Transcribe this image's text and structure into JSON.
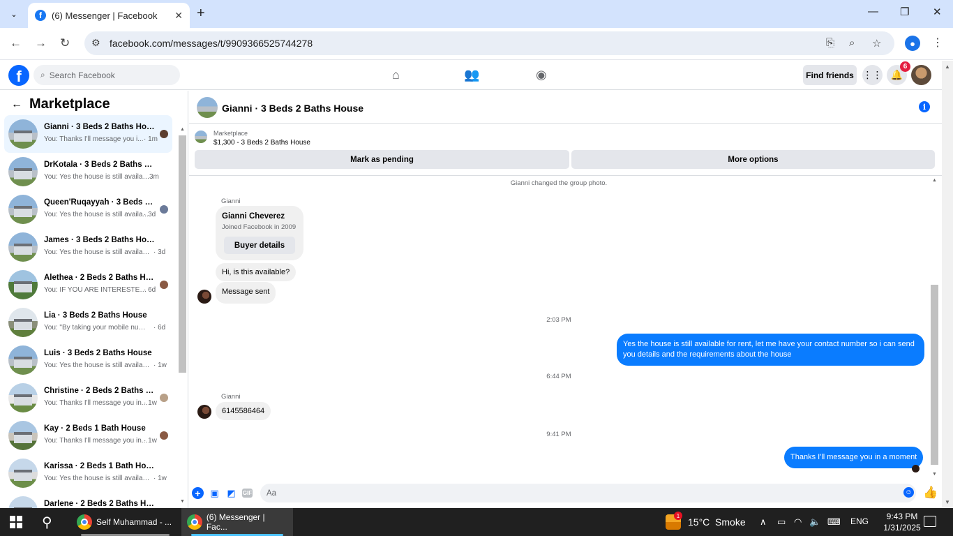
{
  "browser": {
    "tab_title": "(6) Messenger | Facebook",
    "url": "facebook.com/messages/t/9909366525744278"
  },
  "fb": {
    "search_placeholder": "Search Facebook",
    "find_friends": "Find friends",
    "notif_count": "6"
  },
  "sidebar": {
    "title": "Marketplace",
    "conversations": [
      {
        "name": "Gianni · 3 Beds 2 Baths House",
        "preview": "You: Thanks I'll message you i...",
        "time": "· 1m"
      },
      {
        "name": "DrKotala · 3 Beds 2 Baths House",
        "preview": "You: Yes the house is still availabl...",
        "time": "3m"
      },
      {
        "name": "Queen'Ruqayyah · 3 Beds 2 B...",
        "preview": "You: Yes the house is still availa...",
        "time": "· 3d"
      },
      {
        "name": "James · 3 Beds 2 Baths House",
        "preview": "You: Yes the house is still available...",
        "time": "· 3d"
      },
      {
        "name": "Alethea · 2 Beds 2 Baths Hou...",
        "preview": "You: IF YOU ARE INTERESTED S...",
        "time": "· 6d"
      },
      {
        "name": "Lia · 3 Beds 2 Baths House",
        "preview": "You: \"By taking your mobile numb...",
        "time": "· 6d"
      },
      {
        "name": "Luis · 3 Beds 2 Baths House",
        "preview": "You: Yes the house is still availabl...",
        "time": "· 1w"
      },
      {
        "name": "Christine · 2 Beds 2 Baths Ho...",
        "preview": "You: Thanks I'll message you in...",
        "time": "· 1w"
      },
      {
        "name": "Kay · 2 Beds 1 Bath House",
        "preview": "You: Thanks I'll message you in...",
        "time": "· 1w"
      },
      {
        "name": "Karissa · 2 Beds 1 Bath House",
        "preview": "You: Yes the house is still availabl...",
        "time": "· 1w"
      },
      {
        "name": "Darlene · 2 Beds 2 Baths Hou...",
        "preview": "",
        "time": ""
      }
    ]
  },
  "chat": {
    "title": "Gianni · 3 Beds 2 Baths House",
    "marketplace_label": "Marketplace",
    "listing": "$1,300 - 3 Beds 2 Baths House",
    "mark_pending": "Mark as pending",
    "more_options": "More options",
    "system_msg": "Gianni changed the group photo.",
    "sender": "Gianni",
    "card_name": "Gianni Cheverez",
    "card_sub": "Joined Facebook in 2009",
    "card_button": "Buyer details",
    "msg1": "Hi, is this available?",
    "msg2": "Message sent",
    "time1": "2:03 PM",
    "out1": "Yes the house is still available for rent, let me have your contact number so i can send you details and the requirements about the house",
    "time2": "6:44 PM",
    "sender2": "Gianni",
    "msg3": "6145586464",
    "time3": "9:41 PM",
    "out2": "Thanks I'll message you in a moment",
    "composer_placeholder": "Aa"
  },
  "taskbar": {
    "app1": "Self Muhammad - ...",
    "app2": "(6) Messenger | Fac...",
    "weather_badge": "1",
    "weather": "15°C  Smoke",
    "lang": "ENG",
    "time": "9:43 PM",
    "date": "1/31/2025"
  }
}
